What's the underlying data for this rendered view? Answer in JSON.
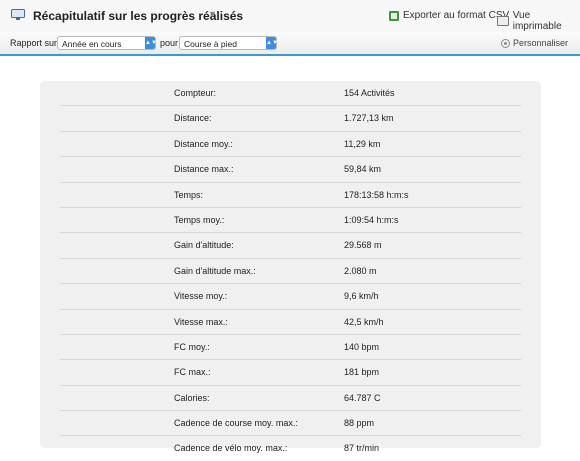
{
  "header": {
    "title": "Récapitulatif sur les progrès réalisés",
    "export_csv": "Exporter au format CSV",
    "printable": "Vue imprimable"
  },
  "toolbar": {
    "report_label": "Rapport sur",
    "period_value": "Année en cours",
    "for_label": "pour",
    "activity_value": "Course à pied",
    "customize": "Personnaliser"
  },
  "stats": [
    {
      "label": "Compteur:",
      "value": "154 Activités"
    },
    {
      "label": "Distance:",
      "value": "1.727,13 km"
    },
    {
      "label": "Distance moy.:",
      "value": "11,29 km"
    },
    {
      "label": "Distance max.:",
      "value": "59,84 km"
    },
    {
      "label": "Temps:",
      "value": "178:13:58 h:m:s"
    },
    {
      "label": "Temps moy.:",
      "value": "1:09:54 h:m:s"
    },
    {
      "label": "Gain d'altitude:",
      "value": "29.568 m"
    },
    {
      "label": "Gain d'altitude max.:",
      "value": "2.080 m"
    },
    {
      "label": "Vitesse moy.:",
      "value": "9,6 km/h"
    },
    {
      "label": "Vitesse max.:",
      "value": "42,5 km/h"
    },
    {
      "label": "FC moy.:",
      "value": "140 bpm"
    },
    {
      "label": "FC max.:",
      "value": "181 bpm"
    },
    {
      "label": "Calories:",
      "value": "64.787 C"
    },
    {
      "label": "Cadence de course moy. max.:",
      "value": "88 ppm"
    },
    {
      "label": "Cadence de vélo moy. max.:",
      "value": "87 tr/min"
    }
  ],
  "colors": {
    "accent": "#3d9ad1",
    "select_arrow": "#3d8ee0",
    "panel_bg": "#f0f0f0",
    "csv_icon": "#3a9a3a"
  },
  "icons": {
    "title": "monitor-icon",
    "csv": "spreadsheet-icon",
    "print": "printer-icon",
    "customize": "gear-icon"
  }
}
